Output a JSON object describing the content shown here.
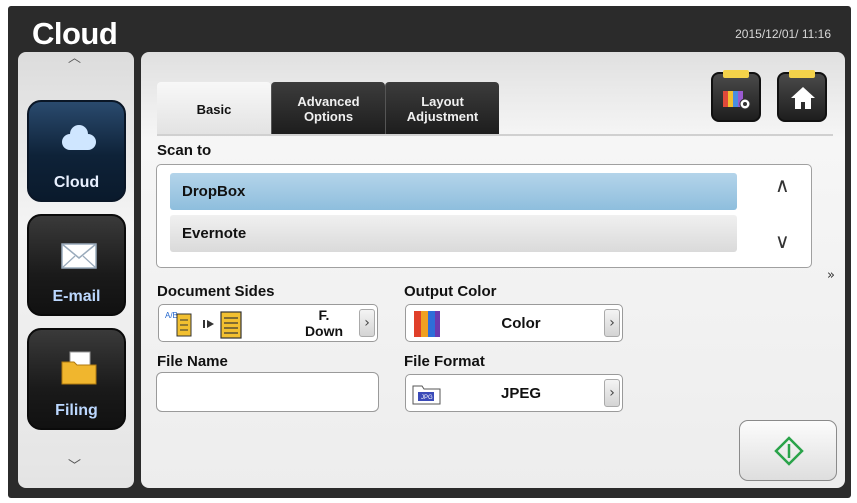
{
  "header": {
    "app_title": "Cloud",
    "datetime": "2015/12/01/ 11:16"
  },
  "sidebar": {
    "items": [
      {
        "label": "Cloud",
        "icon": "cloud-icon",
        "active": true
      },
      {
        "label": "E-mail",
        "icon": "envelope-icon",
        "active": false
      },
      {
        "label": "Filing",
        "icon": "folder-icon",
        "active": false
      }
    ]
  },
  "tabs": [
    {
      "label": "Basic",
      "active": true
    },
    {
      "label": "Advanced Options",
      "active": false
    },
    {
      "label": "Layout Adjustment",
      "active": false
    }
  ],
  "toolbar": {
    "profile_icon": "scan-profile-icon",
    "home_icon": "home-icon"
  },
  "scan_to": {
    "label": "Scan to",
    "options": [
      "DropBox",
      "Evernote"
    ],
    "selected": "DropBox"
  },
  "document_sides": {
    "label": "Document Sides",
    "value_line1": "F.",
    "value_line2": "Down"
  },
  "output_color": {
    "label": "Output Color",
    "value": "Color"
  },
  "file_name": {
    "label": "File Name",
    "value": ""
  },
  "file_format": {
    "label": "File Format",
    "value": "JPEG"
  },
  "colors": {
    "selected_row": "#9cc6e2",
    "start_icon": "#2aa34a",
    "active_sidebar": "#0e2238"
  }
}
